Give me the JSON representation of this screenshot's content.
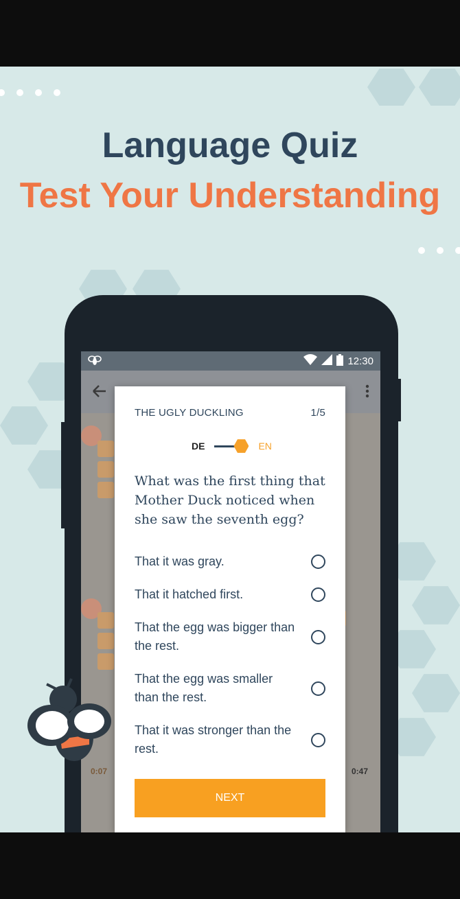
{
  "headline": {
    "title": "Language Quiz",
    "subtitle": "Test Your Understanding"
  },
  "status_bar": {
    "time": "12:30",
    "icons": [
      "bee-icon",
      "wifi-icon",
      "signal-icon",
      "battery-icon"
    ]
  },
  "app_bar": {
    "icons": [
      "back-arrow-icon",
      "more-vert-icon"
    ]
  },
  "player": {
    "elapsed": "0:07",
    "total": "0:47"
  },
  "quiz": {
    "story_title": "THE UGLY DUCKLING",
    "progress": "1/5",
    "lang_from": "DE",
    "lang_to": "EN",
    "question": "What was the first thing that Mother Duck noticed when she saw the seventh egg?",
    "options": [
      "That it was gray.",
      "That it hatched first.",
      "That the egg was bigger than the rest.",
      "That the egg was smaller than the rest.",
      "That it was stronger than the rest."
    ],
    "next_label": "NEXT"
  },
  "colors": {
    "navy": "#2f465c",
    "orange": "#ef7645",
    "accent": "#f8a021",
    "background": "#d7e9e8"
  }
}
